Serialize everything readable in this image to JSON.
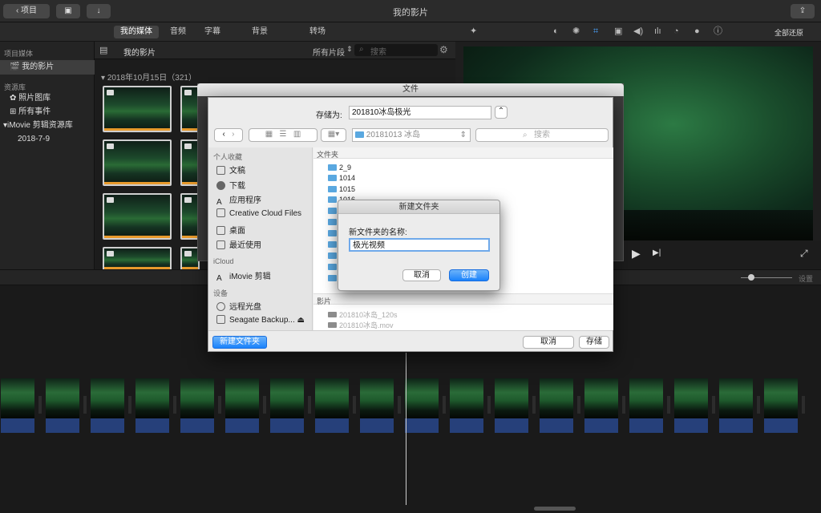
{
  "window": {
    "title": "我的影片"
  },
  "toolbar": {
    "back_label": "项目"
  },
  "media_tabs": [
    "我的媒体",
    "音频",
    "字幕",
    "背景",
    "转场"
  ],
  "sidebar": {
    "project_header": "项目媒体",
    "project_item": "我的影片",
    "library_header": "资源库",
    "library_items": [
      "照片图库",
      "所有事件",
      "iMovie 剪辑资源库",
      "2018-7-9"
    ]
  },
  "browser": {
    "title": "我的影片",
    "filter": "所有片段",
    "search_placeholder": "搜索",
    "date_group": "2018年10月15日（321）"
  },
  "viewer": {
    "reset_all": "全部还原"
  },
  "timeline": {
    "settings": "设置"
  },
  "save_dialog": {
    "title": "文件",
    "save_as_label": "存储为:",
    "save_as_value": "201810冰岛极光",
    "location": "20181013 冰岛",
    "search_placeholder": "搜索",
    "favorites_header": "个人收藏",
    "favorites": [
      "文稿",
      "下载",
      "应用程序",
      "Creative Cloud Files",
      "桌面",
      "最近使用"
    ],
    "icloud_header": "iCloud",
    "icloud_items": [
      "iMovie 剪辑"
    ],
    "devices_header": "设备",
    "devices": [
      "远程光盘",
      "Seagate Backup..."
    ],
    "folders_header": "文件夹",
    "folders": [
      "2_9",
      "1014",
      "1015",
      "1016"
    ],
    "movies_header": "影片",
    "movies": [
      "201810冰岛_120s",
      "201810冰岛.mov"
    ],
    "new_folder_button": "新建文件夹",
    "cancel_button": "取消",
    "save_button": "存储"
  },
  "new_folder_dialog": {
    "title": "新建文件夹",
    "name_label": "新文件夹的名称:",
    "name_value": "极光视频",
    "cancel_button": "取消",
    "create_button": "创建"
  }
}
